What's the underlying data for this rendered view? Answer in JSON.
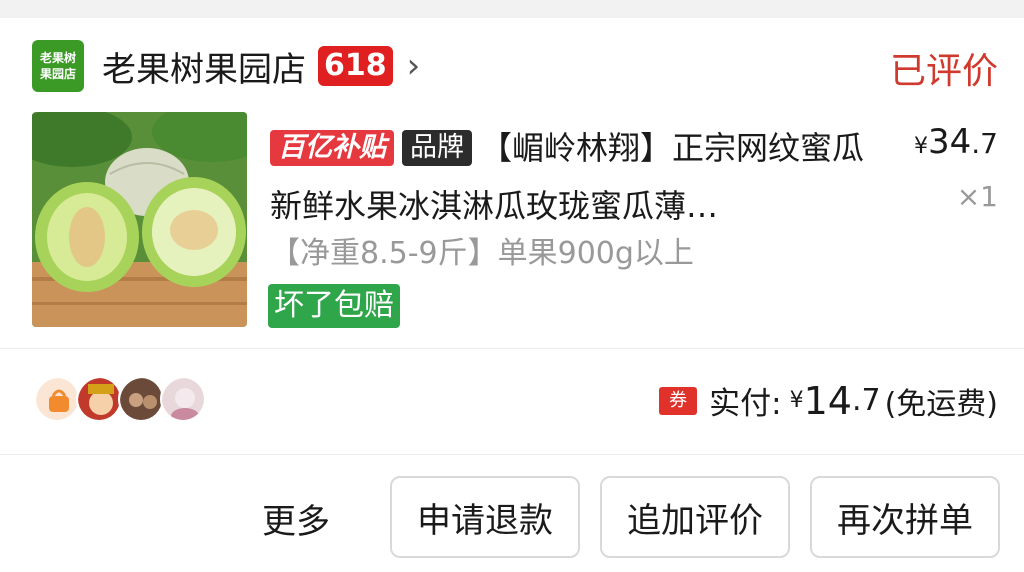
{
  "store": {
    "logo_line1": "老果树",
    "logo_line2": "果园店",
    "name": "老果树果园店",
    "badge": "618",
    "chevron": "›"
  },
  "order_status": "已评价",
  "product": {
    "tag_subsidy": "百亿补贴",
    "tag_brand": "品牌",
    "title": "【嵋岭林翔】正宗网纹蜜瓜新鲜水果冰淇淋瓜玫珑蜜瓜薄…",
    "price_yen": "¥",
    "price_int": "34",
    "price_dec": ".7",
    "quantity": "×1",
    "spec": "【净重8.5-9斤】单果900g以上",
    "guarantee": "坏了包赔"
  },
  "payment": {
    "coupon_label": "券",
    "label": "实付:",
    "yen": "¥",
    "amount_int": "14",
    "amount_dec": ".7",
    "note": "(免运费)"
  },
  "actions": {
    "more": "更多",
    "refund": "申请退款",
    "add_review": "追加评价",
    "rebuy": "再次拼单"
  },
  "colors": {
    "status_red": "#d03a2e",
    "subsidy_red": "#e5393f",
    "guarantee_green": "#2fa64a",
    "logo_green": "#3b9a26"
  }
}
